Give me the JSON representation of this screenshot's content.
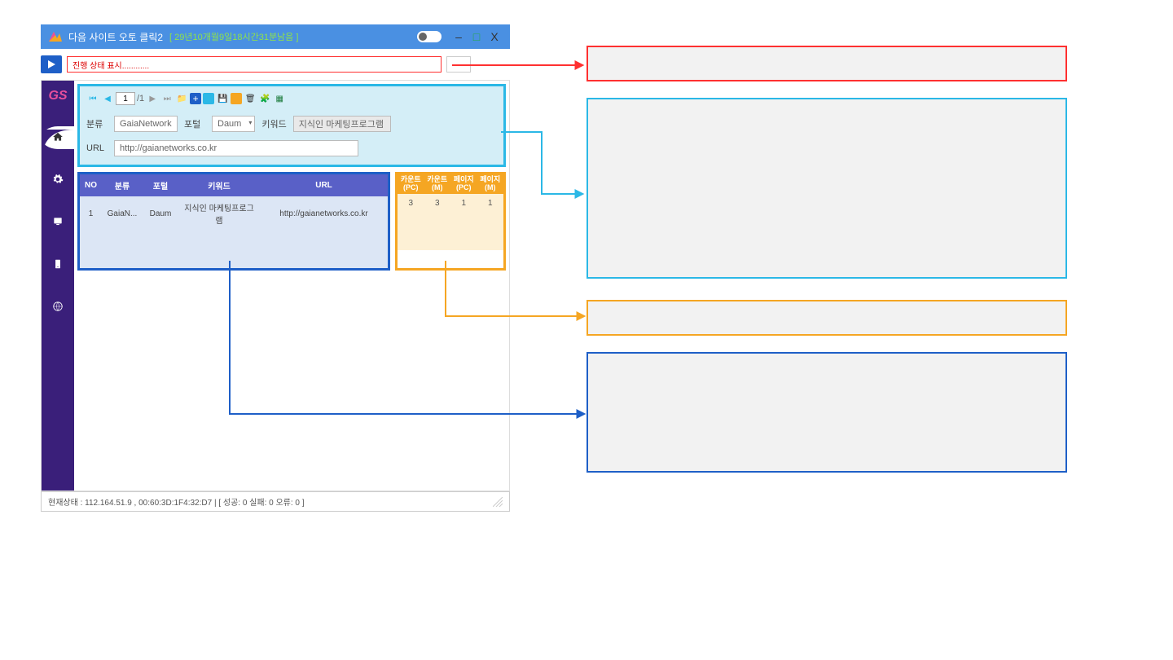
{
  "titlebar": {
    "app_title": "다음 사이트 오토 클릭2",
    "remaining": "[ 29년10개월9일18시간31분남음 ]"
  },
  "status": {
    "progress_text": "진행 상태 표시............"
  },
  "sidebar": {
    "gs": "GS"
  },
  "toolbar": {
    "page_current": "1",
    "page_total": "/1"
  },
  "form": {
    "category_label": "분류",
    "category_value": "GaiaNetwork",
    "portal_label": "포털",
    "portal_value": "Daum",
    "keyword_label": "키워드",
    "keyword_value": "지식인 마케팅프로그램",
    "url_label": "URL",
    "url_value": "http://gaianetworks.co.kr"
  },
  "table_left": {
    "headers": {
      "no": "NO",
      "category": "분류",
      "portal": "포털",
      "keyword": "키워드",
      "url": "URL"
    },
    "rows": [
      {
        "no": "1",
        "category": "GaiaN...",
        "portal": "Daum",
        "keyword": "지식인 마케팅프로그램",
        "url": "http://gaianetworks.co.kr"
      }
    ]
  },
  "table_right": {
    "headers": {
      "c1a": "카운트",
      "c1b": "(PC)",
      "c2a": "카운트",
      "c2b": "(M)",
      "c3a": "페이지",
      "c3b": "(PC)",
      "c4a": "페이지",
      "c4b": "(M)"
    },
    "rows": [
      {
        "c1": "3",
        "c2": "3",
        "c3": "1",
        "c4": "1"
      }
    ]
  },
  "statusbar": {
    "text": "현재상태 :  112.164.51.9 ,  00:60:3D:1F4:32:D7  | [  성공:   0  실패:  0  오류:   0  ]"
  }
}
